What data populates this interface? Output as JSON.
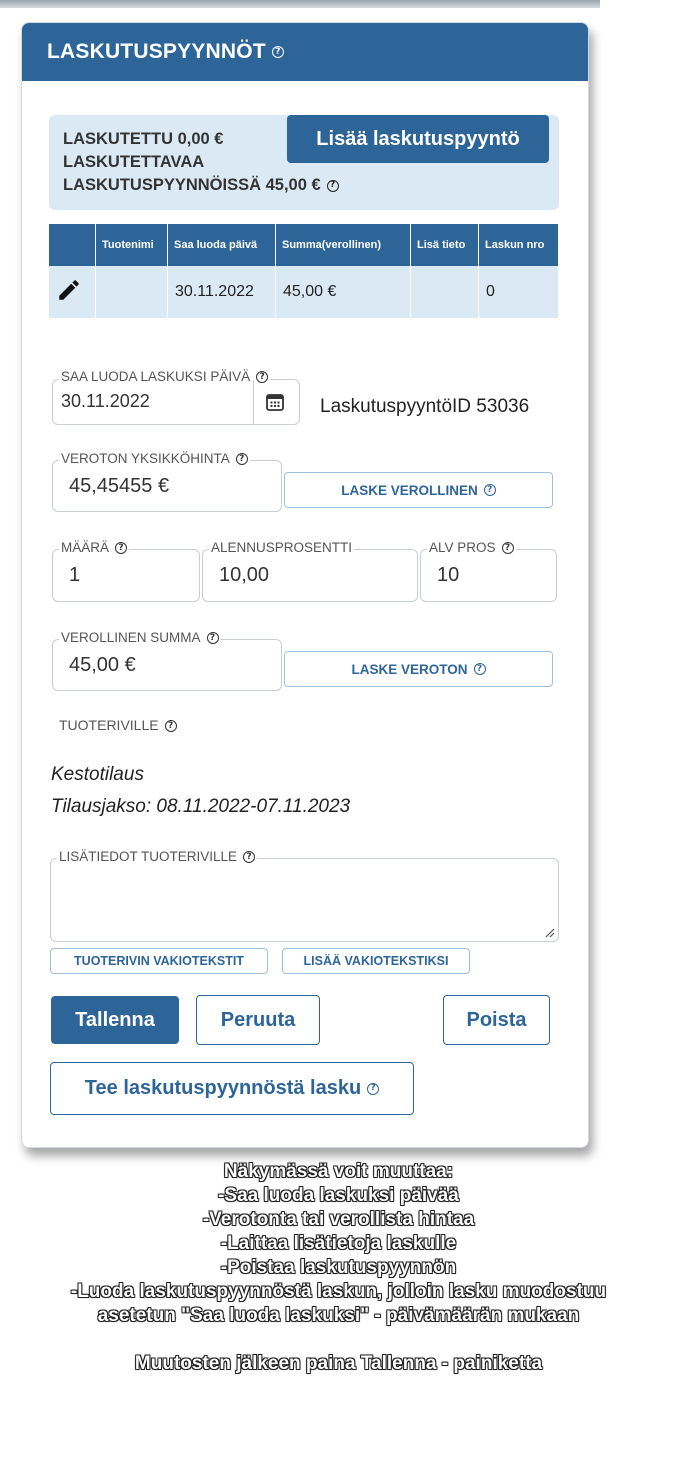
{
  "header": {
    "title": "LASKUTUSPYYNNÖT"
  },
  "summary": {
    "invoiced": "LASKUTETTU 0,00 €",
    "to_invoice_line1": "LASKUTETTAVAA",
    "to_invoice_line2": "LASKUTUSPYYNNÖISSÄ 45,00 €",
    "add_button": "Lisää laskutuspyyntö"
  },
  "table": {
    "headers": [
      "",
      "Tuotenimi",
      "Saa luoda päivä",
      "Summa(verollinen)",
      "Lisä tieto",
      "Laskun nro"
    ],
    "rows": [
      {
        "product": "",
        "date": "30.11.2022",
        "sum": "45,00 €",
        "info": "",
        "invoice_no": "0"
      }
    ]
  },
  "form": {
    "date_label": "SAA LUODA LASKUKSI PÄIVÄ",
    "date_value": "30.11.2022",
    "request_id": "LaskutuspyyntöID 53036",
    "net_label": "VEROTON YKSIKKÖHINTA",
    "net_value": "45,45455 €",
    "calc_gross_button": "LASKE VEROLLINEN",
    "qty_label": "MÄÄRÄ",
    "qty_value": "1",
    "discount_label": "ALENNUSPROSENTTI",
    "discount_value": "10,00",
    "vat_label": "ALV PROS",
    "vat_value": "10",
    "gross_label": "VEROLLINEN SUMMA",
    "gross_value": "45,00 €",
    "calc_net_button": "LASKE VEROTON",
    "product_row_label": "TUOTERIVILLE",
    "subscription": "Kestotilaus",
    "period": "Tilausjakso: 08.11.2022-07.11.2023",
    "extra_label": "LISÄTIEDOT TUOTERIVILLE",
    "extra_value": "",
    "std_text_button": "TUOTERIVIN VAKIOTEKSTIT",
    "add_std_button": "LISÄÄ VAKIOTEKSTIKSI"
  },
  "actions": {
    "save": "Tallenna",
    "cancel": "Peruuta",
    "delete": "Poista",
    "create_invoice": "Tee laskutuspyynnöstä lasku"
  },
  "caption": [
    "Näkymässä voit muuttaa:",
    "-Saa luoda laskuksi päivää",
    "-Verotonta tai verollista hintaa",
    "-Laittaa lisätietoja laskulle",
    "-Poistaa laskutuspyynnön",
    "-Luoda laskutuspyynnöstä laskun, jolloin lasku muodostuu",
    "asetetun \"Saa luoda laskuksi\" - päivämäärän mukaan",
    "",
    "Muutosten jälkeen paina Tallenna - painiketta"
  ],
  "colors": {
    "primary": "#2e6599",
    "light": "#dbe9f5"
  }
}
